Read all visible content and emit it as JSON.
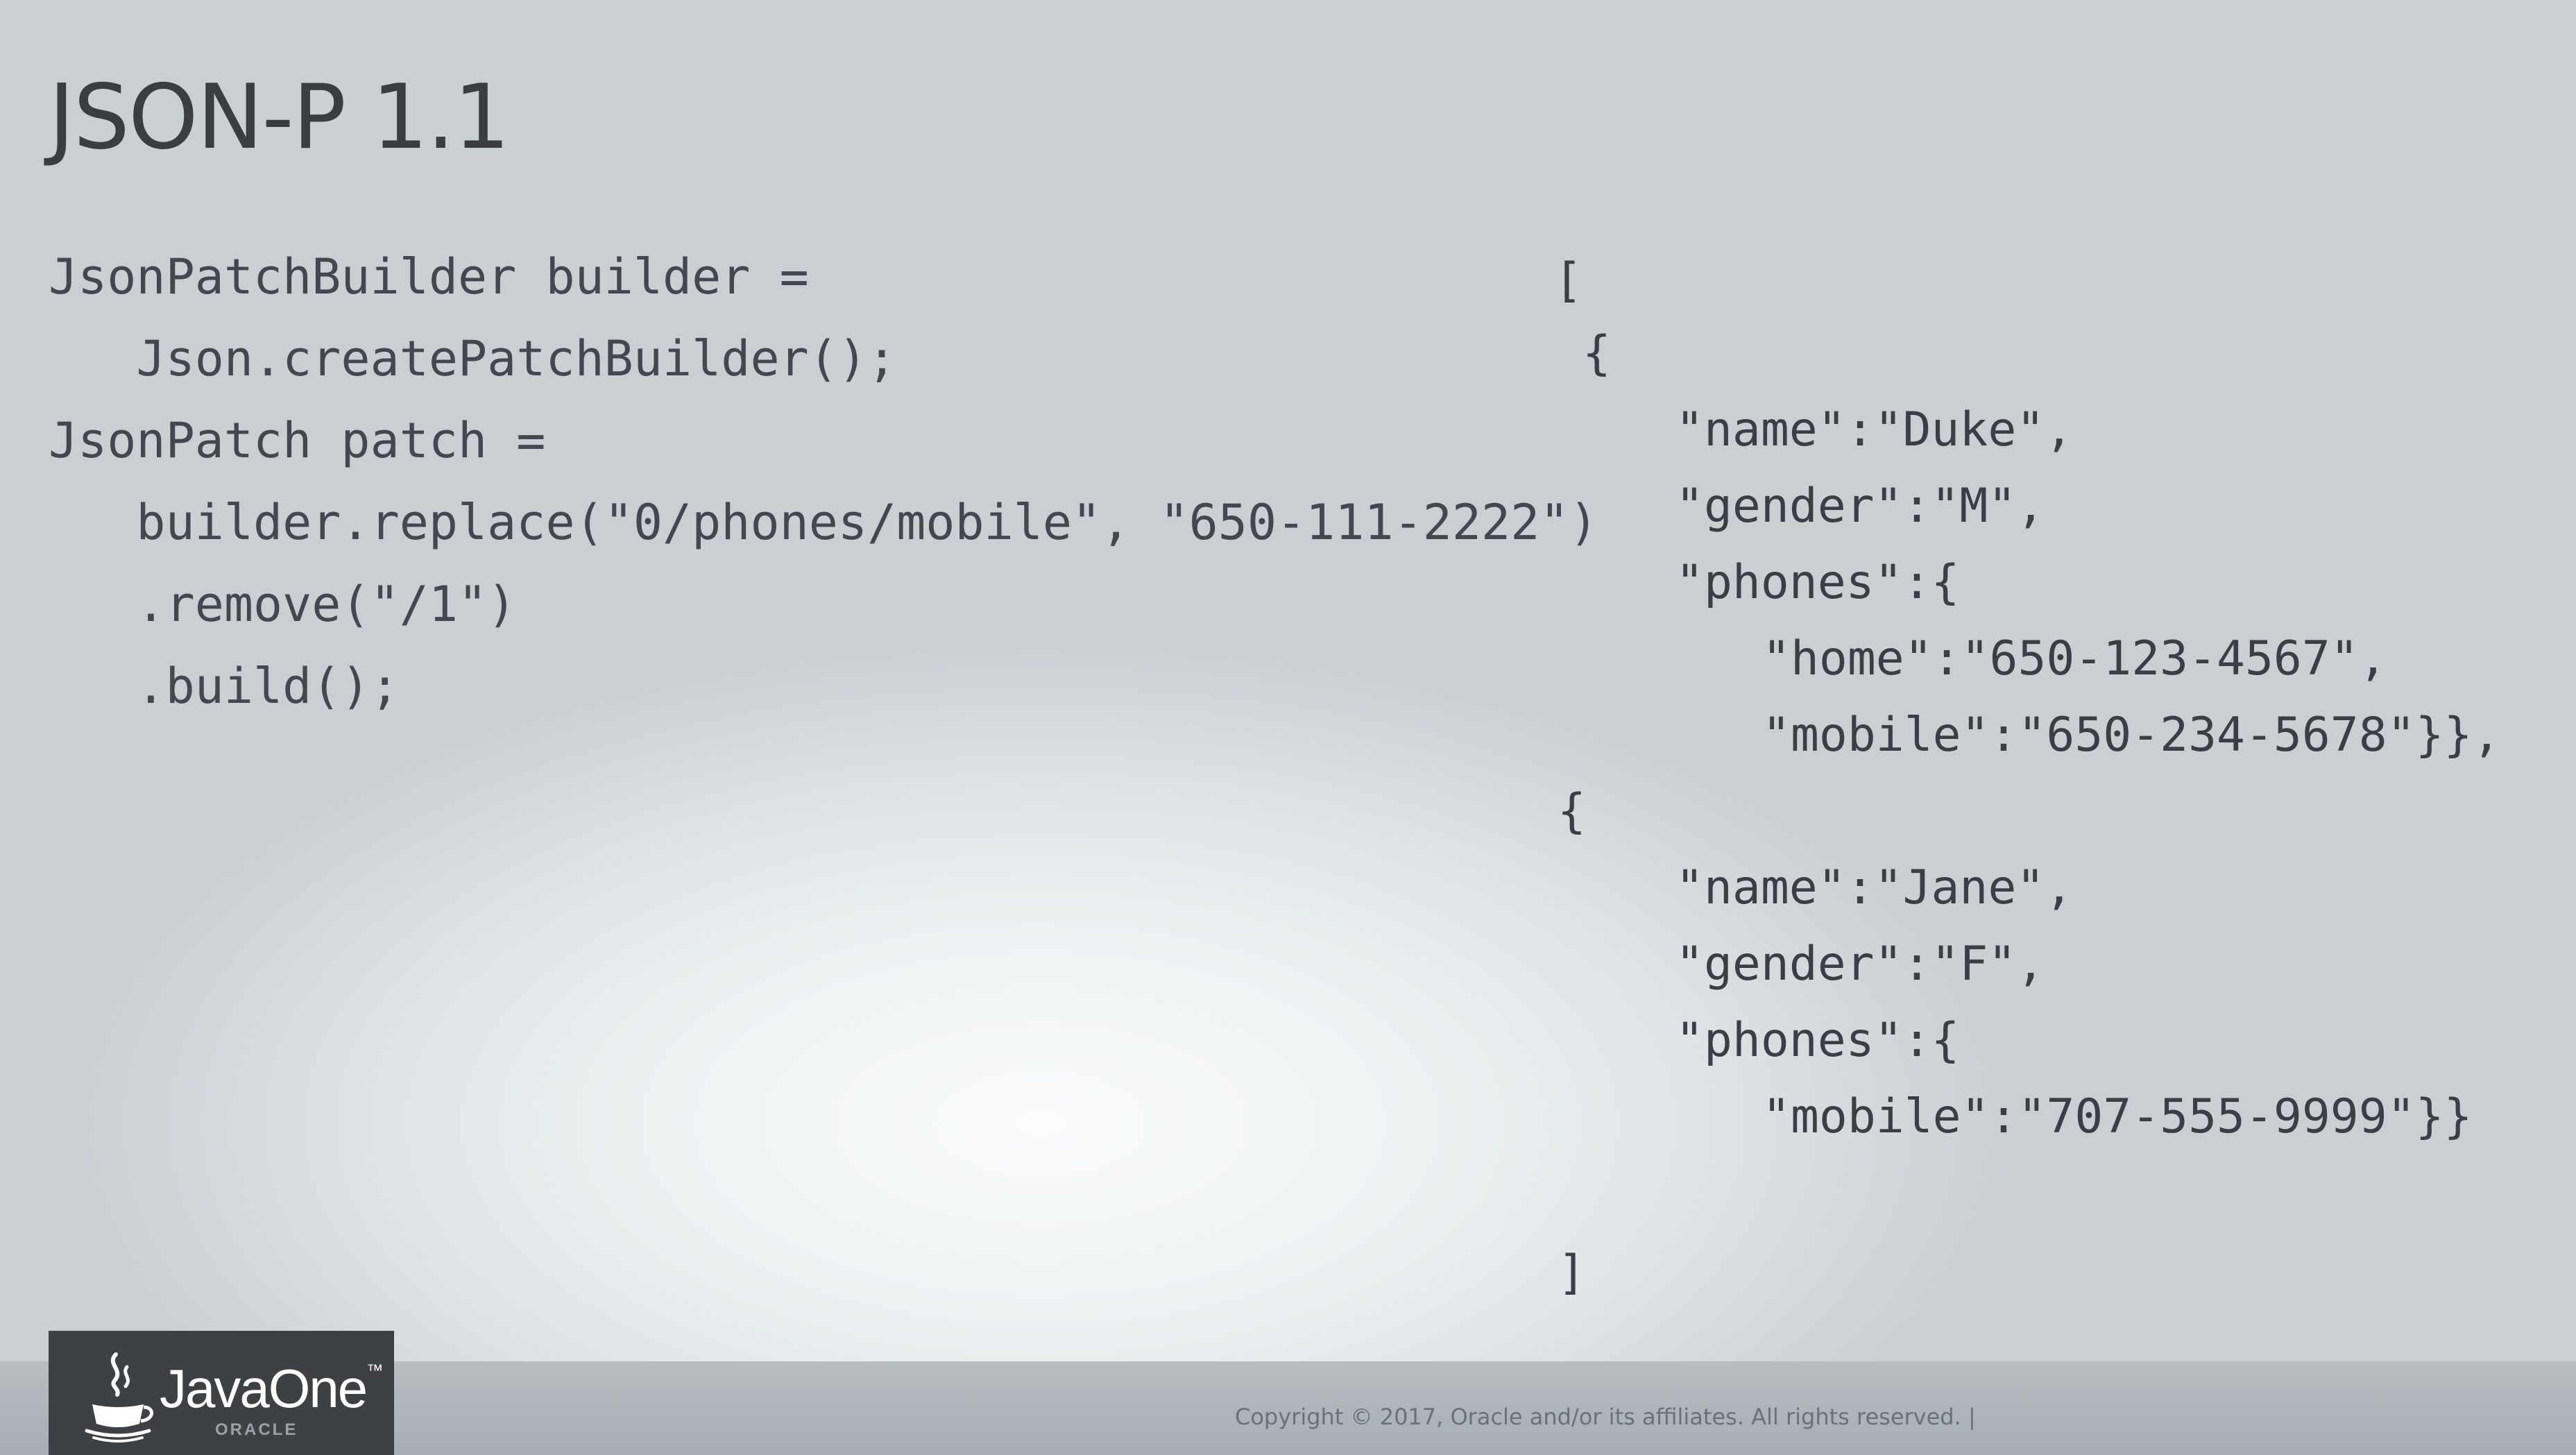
{
  "slide": {
    "title": "JSON-P 1.1"
  },
  "code_left": [
    "JsonPatchBuilder builder =",
    "   Json.createPatchBuilder();",
    "JsonPatch patch =",
    "   builder.replace(\"0/phones/mobile\", \"650-111-2222\")",
    "   .remove(\"/1\")",
    "   .build();"
  ],
  "code_right": [
    "[",
    " {",
    "\"name\":\"Duke\",",
    "\"gender\":\"M\",",
    "\"phones\":{",
    "\"home\":\"650-123-4567\",",
    "\"mobile\":\"650-234-5678\"}},",
    "{",
    "\"name\":\"Jane\",",
    "\"gender\":\"F\",",
    "\"phones\":{",
    "\"mobile\":\"707-555-9999\"}}",
    "]"
  ],
  "footer": {
    "copyright": "Copyright © 2017, Oracle and/or its affiliates. All rights reserved.  |",
    "logo_text": "JavaOne",
    "logo_tm": "™",
    "logo_sub": "ORACLE"
  },
  "colors": {
    "title": "#3a3e42",
    "code": "#434850",
    "logo_bg": "#3e4144",
    "footer_bar": "#aeb4b8"
  },
  "icons": {
    "logo_icon": "java-cup-icon"
  }
}
